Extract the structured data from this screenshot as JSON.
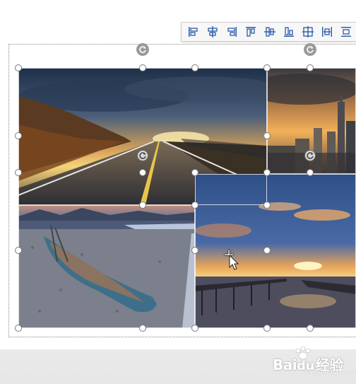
{
  "toolbar": {
    "buttons": [
      {
        "name": "align-left-icon"
      },
      {
        "name": "align-center-icon"
      },
      {
        "name": "align-right-icon"
      },
      {
        "name": "align-top-icon"
      },
      {
        "name": "align-middle-icon"
      },
      {
        "name": "align-bottom-icon"
      },
      {
        "name": "distribute-grid-icon"
      },
      {
        "name": "distribute-horizontally-icon"
      },
      {
        "name": "distribute-vertically-icon"
      }
    ]
  },
  "photos": [
    {
      "name": "photo-road-sunset",
      "subject": "highway road at sunset"
    },
    {
      "name": "photo-city-skyline",
      "subject": "city skyline in golden fog"
    },
    {
      "name": "photo-rowboat-shore",
      "subject": "rowboat on pebble shore"
    },
    {
      "name": "photo-pier-sunset",
      "subject": "pier over water at sunset"
    }
  ],
  "watermark": {
    "brand": "Bai",
    "brand_suffix": "经验",
    "url": "jingyan.baidu.com"
  },
  "colors": {
    "handle_border": "#7a7a7a",
    "rotate_handle": "#9a9a9a",
    "toolbar_bg": "#f7f7f7"
  }
}
